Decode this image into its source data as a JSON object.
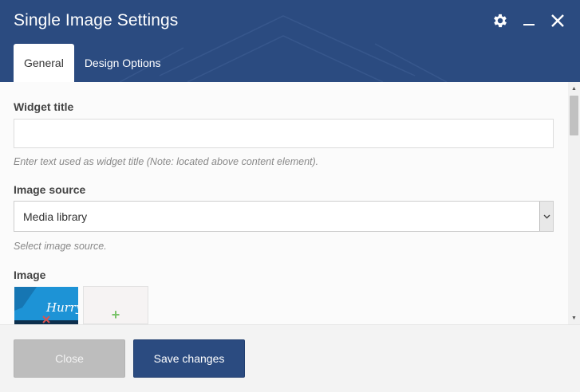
{
  "window": {
    "title": "Single Image Settings",
    "icons": [
      "gear-icon",
      "minimize-icon",
      "close-icon"
    ]
  },
  "tabs": [
    {
      "label": "General",
      "active": true
    },
    {
      "label": "Design Options",
      "active": false
    }
  ],
  "fields": {
    "widget_title": {
      "label": "Widget title",
      "value": "",
      "help": "Enter text used as widget title (Note: located above content element)."
    },
    "image_source": {
      "label": "Image source",
      "value": "Media library",
      "help": "Select image source."
    },
    "image": {
      "label": "Image",
      "thumbnail_text": "Hurry",
      "add_icon": "plus-icon"
    }
  },
  "footer": {
    "close_label": "Close",
    "save_label": "Save changes"
  },
  "colors": {
    "header": "#2b4b80",
    "primary_button": "#2b4b80",
    "close_button": "#bdbdbd",
    "add_plus": "#7ac36a"
  }
}
